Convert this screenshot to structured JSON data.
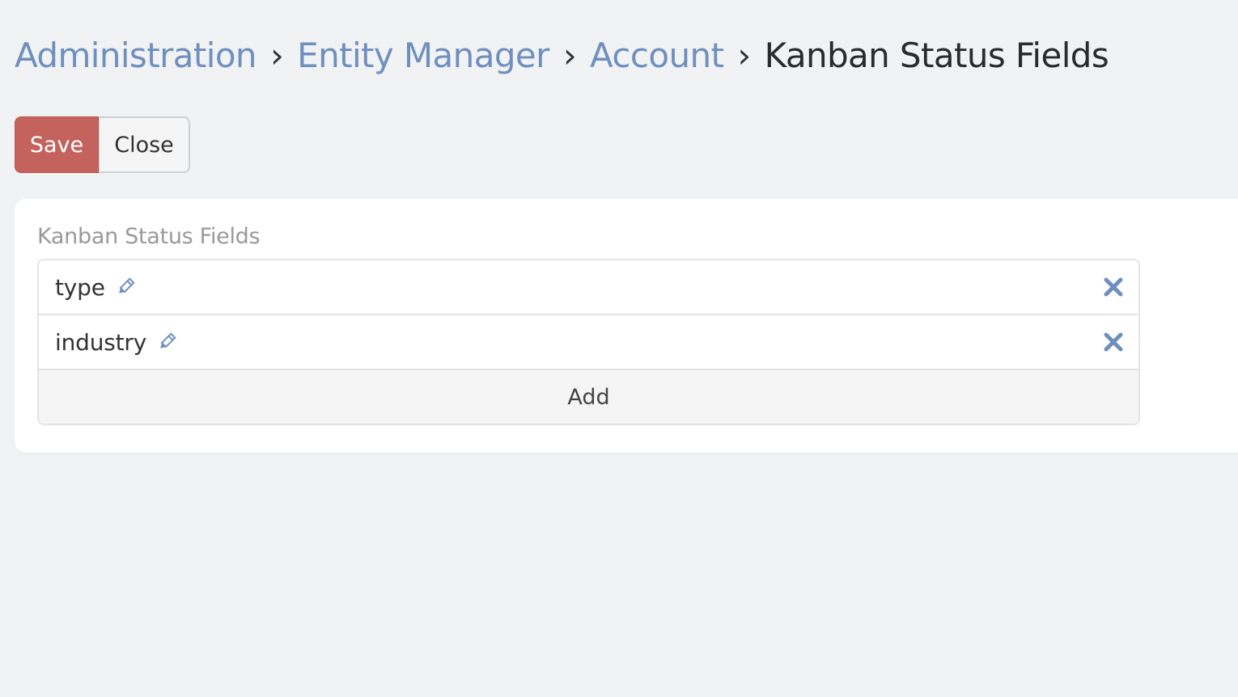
{
  "breadcrumb": {
    "items": [
      {
        "label": "Administration"
      },
      {
        "label": "Entity Manager"
      },
      {
        "label": "Account"
      }
    ],
    "separator": "›",
    "current": "Kanban Status Fields"
  },
  "toolbar": {
    "save_label": "Save",
    "close_label": "Close"
  },
  "panel": {
    "field_label": "Kanban Status Fields",
    "items": [
      {
        "label": "type",
        "edit_icon": "pencil-icon",
        "remove_icon": "close-icon"
      },
      {
        "label": "industry",
        "edit_icon": "pencil-icon",
        "remove_icon": "close-icon"
      }
    ],
    "add_label": "Add"
  },
  "colors": {
    "link": "#6f8fbe",
    "save_button": "#c4625e",
    "icon": "#6f8fbe",
    "background": "#f1f2f4"
  }
}
